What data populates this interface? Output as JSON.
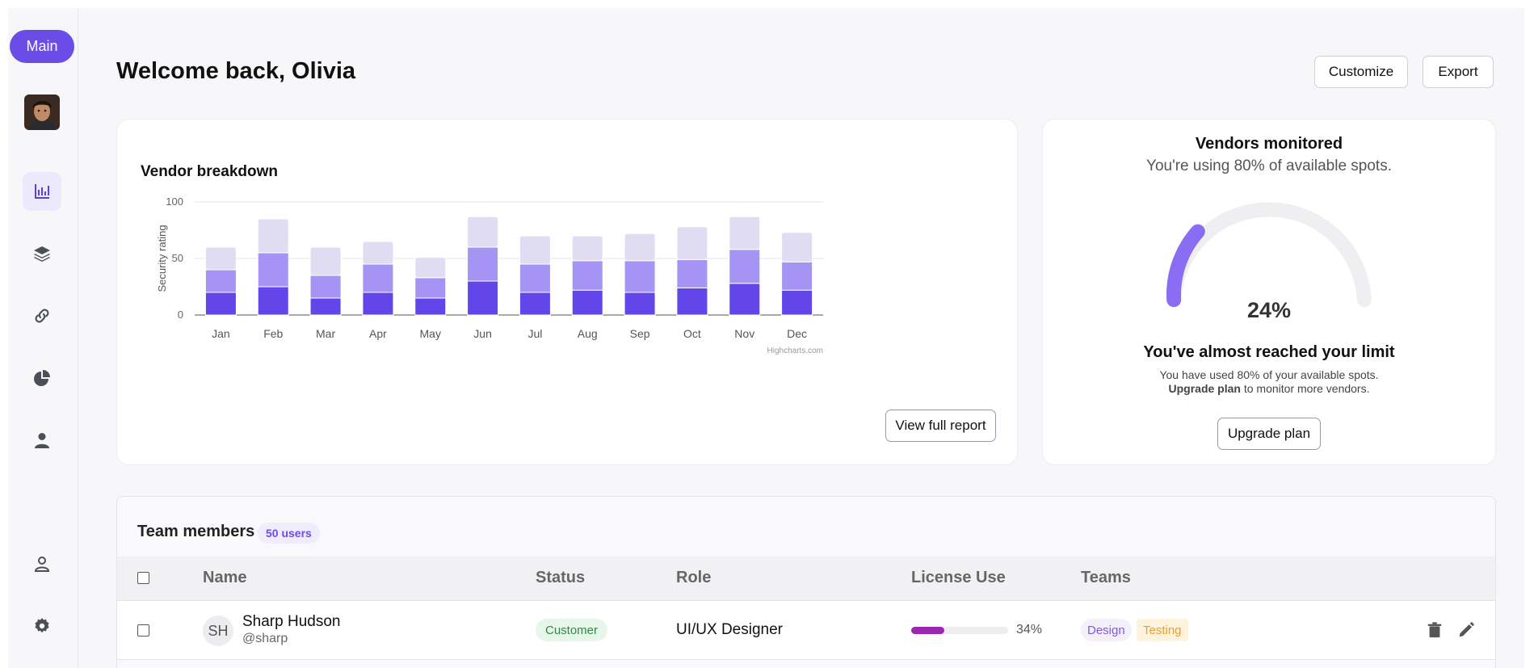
{
  "sidebar": {
    "main_label": "Main",
    "items": [
      {
        "icon": "bar-chart-icon"
      },
      {
        "icon": "layers-icon"
      },
      {
        "icon": "link-icon"
      },
      {
        "icon": "pie-chart-icon"
      },
      {
        "icon": "user-icon"
      },
      {
        "icon": "user-outline-icon"
      },
      {
        "icon": "gear-icon"
      }
    ]
  },
  "header": {
    "title": "Welcome back, Olivia",
    "customize": "Customize",
    "export": "Export"
  },
  "vendor_breakdown": {
    "title": "Vendor breakdown",
    "credit": "Highcharts.com",
    "view_report": "View full report"
  },
  "chart_data": {
    "type": "bar",
    "stacked": true,
    "categories": [
      "Jan",
      "Feb",
      "Mar",
      "Apr",
      "May",
      "Jun",
      "Jul",
      "Aug",
      "Sep",
      "Oct",
      "Nov",
      "Dec"
    ],
    "series": [
      {
        "values": [
          20,
          25,
          15,
          20,
          15,
          30,
          20,
          22,
          20,
          24,
          28,
          22
        ],
        "color": "#6246ea"
      },
      {
        "values": [
          20,
          30,
          20,
          25,
          18,
          30,
          25,
          26,
          28,
          25,
          30,
          25
        ],
        "color": "#a594f4"
      },
      {
        "values": [
          20,
          30,
          25,
          20,
          18,
          27,
          25,
          22,
          24,
          29,
          29,
          26
        ],
        "color": "#e0ddf3"
      }
    ],
    "ylabel": "Security rating",
    "ylim": [
      0,
      100
    ],
    "yticks": [
      0,
      50,
      100
    ],
    "grid": true,
    "legend": false
  },
  "vendors": {
    "title": "Vendors monitored",
    "subtitle": "You're using 80% of available spots.",
    "gauge_value": 24,
    "gauge_label": "24%",
    "limit_title": "You've almost reached your limit",
    "limit_text": "You have used 80% of your available spots.",
    "upgrade_link": "Upgrade plan",
    "upgrade_suffix": " to monitor more vendors.",
    "upgrade_button": "Upgrade plan"
  },
  "team": {
    "title": "Team members",
    "count_badge": "50 users",
    "columns": [
      "Name",
      "Status",
      "Role",
      "License Use",
      "Teams"
    ],
    "rows": [
      {
        "initials": "SH",
        "name": "Sharp Hudson",
        "handle": "@sharp",
        "status": "Customer",
        "role": "UI/UX Designer",
        "license_use": 34,
        "license_label": "34%",
        "teams": [
          "Design",
          "Testing"
        ]
      }
    ]
  }
}
